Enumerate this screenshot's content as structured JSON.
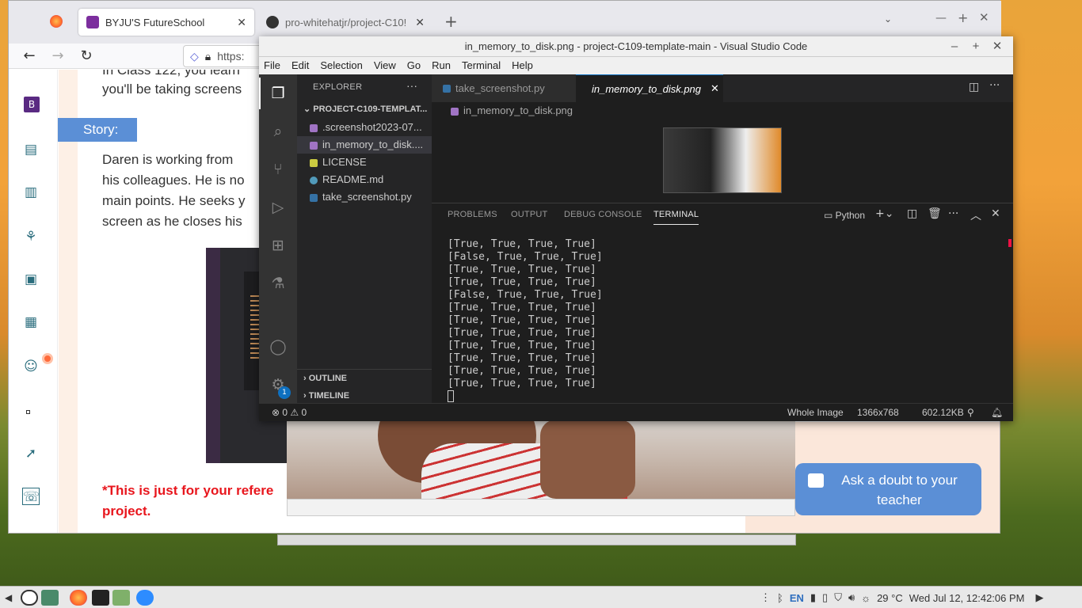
{
  "firefox": {
    "tabs": [
      {
        "title": "BYJU'S FutureSchool",
        "close": "✕"
      },
      {
        "title": "pro-whitehatjr/project-C10!",
        "close": "✕"
      }
    ],
    "new_tab": "+",
    "url_prefix": "https:"
  },
  "byju": {
    "intro_line1": "In Class 122, you learn",
    "intro_line2": "you'll be taking screens",
    "story_label": "Story:",
    "story_lines": [
      "Daren is working from",
      "his colleagues. He is no",
      "main points. He seeks y",
      "screen as he closes his"
    ],
    "note_line1": "*This is just for your refere",
    "note_line2": "project.",
    "doubt_button": "Ask a doubt to your teacher"
  },
  "vscode": {
    "window_title": "in_memory_to_disk.png - project-C109-template-main - Visual Studio Code",
    "menu": [
      "File",
      "Edit",
      "Selection",
      "View",
      "Go",
      "Run",
      "Terminal",
      "Help"
    ],
    "explorer_title": "EXPLORER",
    "folder_name": "PROJECT-C109-TEMPLAT...",
    "files": [
      {
        "name": ".screenshot2023-07...",
        "color": "#a074c4"
      },
      {
        "name": "in_memory_to_disk....",
        "color": "#a074c4"
      },
      {
        "name": "LICENSE",
        "color": "#cbcb41"
      },
      {
        "name": "README.md",
        "color": "#519aba"
      },
      {
        "name": "take_screenshot.py",
        "color": "#3572a5"
      }
    ],
    "outline": "OUTLINE",
    "timeline": "TIMELINE",
    "settings_badge": "1",
    "tabs": [
      "take_screenshot.py",
      "in_memory_to_disk.png"
    ],
    "breadcrumb": "in_memory_to_disk.png",
    "panel_tabs": [
      "PROBLEMS",
      "OUTPUT",
      "DEBUG CONSOLE",
      "TERMINAL"
    ],
    "terminal_profile": "Python",
    "terminal_lines": [
      "[True, True, True, True]",
      "[False, True, True, True]",
      "[True, True, True, True]",
      "[True, True, True, True]",
      "[False, True, True, True]",
      "[True, True, True, True]",
      "[True, True, True, True]",
      "[True, True, True, True]",
      "[True, True, True, True]",
      "[True, True, True, True]",
      "[True, True, True, True]",
      "[True, True, True, True]"
    ],
    "status": {
      "errors": "0",
      "warnings": "0",
      "image_mode": "Whole Image",
      "dimensions": "1366x768",
      "size": "602.12KB"
    }
  },
  "taskbar": {
    "language": "EN",
    "weather": "29 °C",
    "clock": "Wed Jul 12, 12:42:06 PM"
  }
}
